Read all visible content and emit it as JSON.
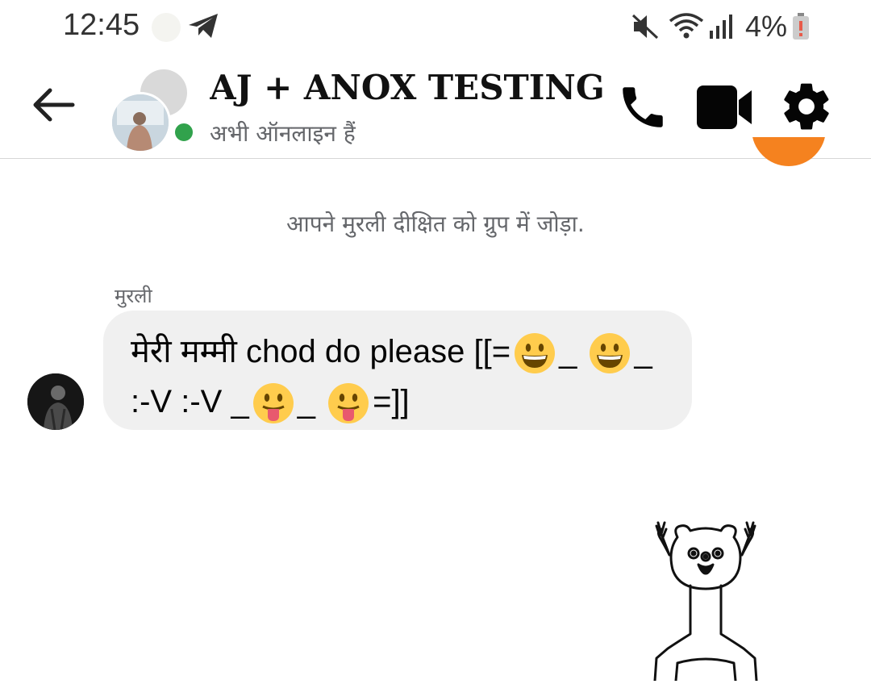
{
  "status_bar": {
    "time": "12:45",
    "battery": "4%",
    "icons": [
      "telegram-icon",
      "mute-icon",
      "wifi-icon",
      "signal-icon",
      "battery-icon"
    ]
  },
  "header": {
    "title": "AJ + ANOX  TESTING ...",
    "status": "अभी ऑनलाइन हैं",
    "icons": [
      "back-arrow-icon",
      "phone-icon",
      "video-camera-icon",
      "gear-icon"
    ]
  },
  "conversation": {
    "system_message": "आपने मुरली दीक्षित को ग्रुप में जोड़ा.",
    "message": {
      "sender": "मुरली",
      "parts": {
        "p1": "मेरी मम्मी chod do please  [[=",
        "p2": "_",
        "p3": "_ :-V :-V  _",
        "p4": "_",
        "p5": "=]]"
      },
      "emojis": [
        "grinning-emoji",
        "grinning-emoji",
        "tongue-emoji",
        "tongue-emoji"
      ]
    },
    "sticker": "bear-sticker"
  },
  "colors": {
    "online": "#31a24c",
    "bubble": "#f0f0f0",
    "secondary_text": "#65676b"
  }
}
